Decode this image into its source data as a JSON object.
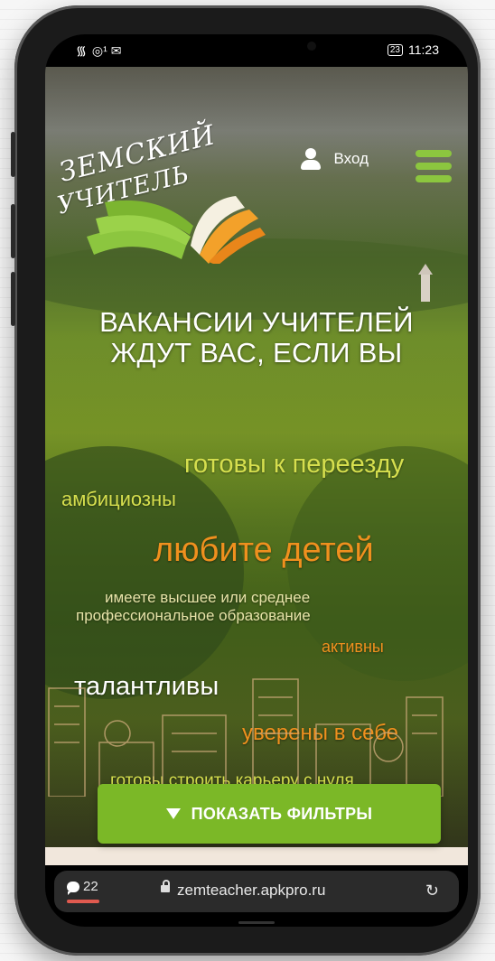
{
  "status_bar": {
    "signal": "᯾",
    "notifications": "◎¹ ✉",
    "battery": "23",
    "time": "11:23"
  },
  "site": {
    "logo_line1": "ЗЕМСКИЙ",
    "logo_line2": "УЧИТЕЛЬ",
    "login_label": "Вход"
  },
  "hero": {
    "headline_line1": "ВАКАНСИИ УЧИТЕЛЕЙ",
    "headline_line2": "ЖДУТ ВАС, ЕСЛИ ВЫ",
    "tags": [
      "готовы к переезду",
      "амбициозны",
      "любите детей",
      "имеете высшее или среднее",
      "профессиональное образование",
      "активны",
      "талантливы",
      "уверены в себе",
      "готовы строить карьеру с нуля"
    ]
  },
  "filter_button": {
    "label": "ПОКАЗАТЬ ФИЛЬТРЫ"
  },
  "browser": {
    "comment_count": "22",
    "url": "zemteacher.apkpro.ru",
    "reload_glyph": "↻"
  },
  "colors": {
    "accent_green": "#8cc63f",
    "button_green": "#7bb827",
    "tag_yellow": "#d6df4e",
    "tag_orange": "#f0901e"
  }
}
